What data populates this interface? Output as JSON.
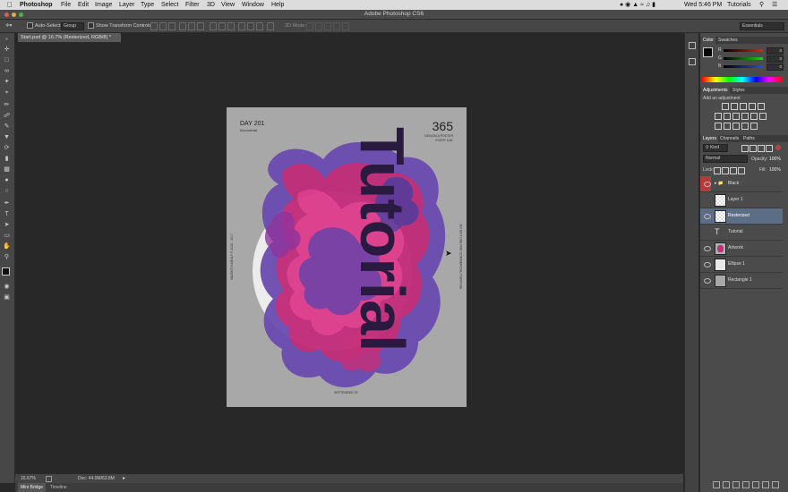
{
  "menubar": {
    "app": "Photoshop",
    "items": [
      "File",
      "Edit",
      "Image",
      "Layer",
      "Type",
      "Select",
      "Filter",
      "3D",
      "View",
      "Window",
      "Help"
    ],
    "clock": "Wed 5:46 PM",
    "user": "Tutorials"
  },
  "titlebar": {
    "title": "Adobe Photoshop CS6"
  },
  "options": {
    "auto_select_label": "Auto-Select:",
    "auto_select_value": "Group",
    "transform_label": "Show Transform Controls",
    "mode3d_label": "3D Mode:",
    "workspace": "Essentials"
  },
  "document": {
    "tab_title": "Start.psd @ 16.7% (Resterized, RGB/8) *",
    "zoom": "16.67%",
    "doc_size": "Doc: 44.0M/63.8M"
  },
  "poster": {
    "day": "DAY 201",
    "day_sub": "Monumental",
    "number": "365",
    "tagline_1": "DESIGN A POSTER",
    "tagline_2": "EVERY DAY",
    "big_word": "Tutorial",
    "left_vertical": "VALENTI KAROLY © 2016 - 2017",
    "right_vertical": "DO NOT USE FOR COMMERCIAL PURPOSE",
    "date": "SEPTEMBER 29"
  },
  "color_panel": {
    "tabs": [
      "Color",
      "Swatches"
    ],
    "channels": [
      "R",
      "G",
      "B"
    ],
    "values": [
      "0",
      "0",
      "0"
    ],
    "colors": {
      "r": "#e02020",
      "g": "#28c828",
      "b": "#2a4ae0"
    }
  },
  "adjustments_panel": {
    "tabs": [
      "Adjustments",
      "Styles"
    ],
    "heading": "Add an adjustment"
  },
  "layers_panel": {
    "tabs": [
      "Layers",
      "Channels",
      "Paths"
    ],
    "kind_label": "Kind",
    "blend_mode": "Normal",
    "opacity_label": "Opacity:",
    "opacity": "100%",
    "lock_label": "Lock:",
    "fill_label": "Fill:",
    "fill": "100%",
    "layers": [
      {
        "name": "Black",
        "type": "group",
        "selected": false
      },
      {
        "name": "Layer 1",
        "type": "pixel",
        "selected": false
      },
      {
        "name": "Resterized",
        "type": "pixel",
        "selected": true
      },
      {
        "name": "Tutorial",
        "type": "text",
        "selected": false
      },
      {
        "name": "Artwork",
        "type": "smart",
        "selected": false
      },
      {
        "name": "Ellipse 1",
        "type": "shape",
        "selected": false
      },
      {
        "name": "Rectangle 1",
        "type": "shape",
        "selected": false
      }
    ]
  },
  "bottom_tabs": [
    "Mini Bridge",
    "Timeline"
  ]
}
